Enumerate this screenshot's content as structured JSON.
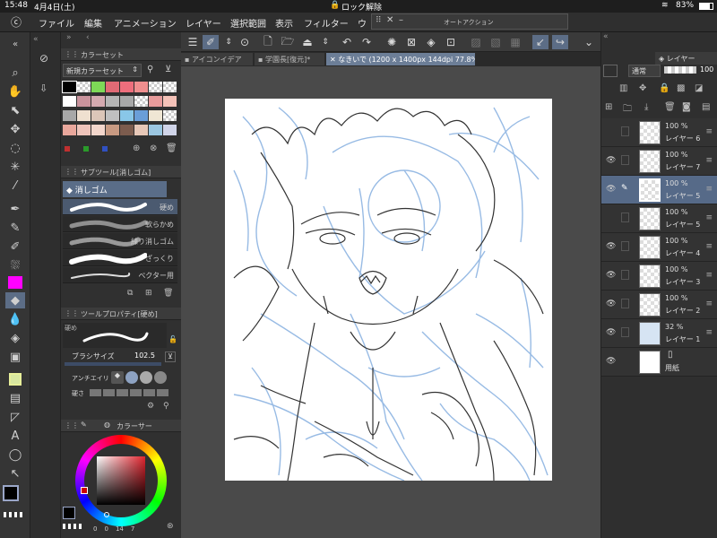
{
  "status": {
    "time": "15:48",
    "date": "4月4日(土)",
    "lock": "ロック解除",
    "battery": "83%"
  },
  "menu": [
    "ファイル",
    "編集",
    "アニメーション",
    "レイヤー",
    "選択範囲",
    "表示",
    "フィルター",
    "ウ"
  ],
  "auto_action": {
    "title": "オートアクション"
  },
  "tabs": [
    {
      "label": "アイコンイデア"
    },
    {
      "label": "学園長[復元]*"
    },
    {
      "label": "なきいで (1200 x 1400px 144dpi 77.8%)"
    }
  ],
  "color_set": {
    "panel_title": "カラーセット",
    "set_name": "新規カラーセット",
    "colors": [
      "#000000",
      "checker",
      "#7ed957",
      "#e06a75",
      "#ee6e7c",
      "#f08f8f",
      "checker",
      "checker",
      "#ffffff",
      "#c9939c",
      "#d4aab0",
      "#b5b5b5",
      "#a8a8a8",
      "checker",
      "#e79b9b",
      "#f4c2b8",
      "#a8a8a8",
      "#efe0d0",
      "#dcc6b8",
      "#c0c0c0",
      "#89c7e8",
      "#6a9ed8",
      "#efe6d4",
      "checker",
      "#e9a79c",
      "#eec3ba",
      "#f3d6cb",
      "#c89a82",
      "#7c5c4e",
      "#e7c8b8",
      "#9bc6e0",
      "#d0d4e8"
    ]
  },
  "subtool": {
    "panel_title": "サブツール[消しゴム]",
    "active": "消しゴム",
    "brushes": [
      "硬め",
      "軟らかめ",
      "練り消しゴム",
      "ざっくり",
      "ベクター用"
    ]
  },
  "tool_property": {
    "panel_title": "ツールプロパティ[硬め]",
    "preset": "硬め",
    "brush_size_label": "ブラシサイズ",
    "brush_size": "102.5",
    "antialias_label": "アンチエイリ",
    "hardness_label": "硬さ"
  },
  "color_wheel": {
    "panel_title": "カラーサー",
    "values": [
      "0",
      "0",
      "14",
      "7"
    ]
  },
  "layers": {
    "panel_title": "レイヤー",
    "blend_mode": "通常",
    "opacity": "100",
    "items": [
      {
        "pct": "100 %",
        "name": "レイヤー 6",
        "visible": false,
        "active": false
      },
      {
        "pct": "100 %",
        "name": "レイヤー 7",
        "visible": true,
        "active": false
      },
      {
        "pct": "100 %",
        "name": "レイヤー 5",
        "visible": true,
        "active": true
      },
      {
        "pct": "100 %",
        "name": "レイヤー 5",
        "visible": false,
        "active": false
      },
      {
        "pct": "100 %",
        "name": "レイヤー 4",
        "visible": true,
        "active": false
      },
      {
        "pct": "100 %",
        "name": "レイヤー 3",
        "visible": true,
        "active": false
      },
      {
        "pct": "100 %",
        "name": "レイヤー 2",
        "visible": true,
        "active": false
      },
      {
        "pct": "32 %",
        "name": "レイヤー 1",
        "visible": true,
        "active": false
      },
      {
        "pct": "",
        "name": "用紙",
        "visible": true,
        "active": false
      }
    ]
  },
  "colors": {
    "accent": "#5c6d86",
    "active_tab": "#6c7e97",
    "sketch_blue": "#8db4e2",
    "line_dark": "#333333",
    "magenta_swatch": "#ff00ff",
    "main_color": "#000000"
  },
  "icons": [
    "app-logo-icon",
    "search-icon",
    "hand-icon",
    "zoom-icon",
    "move-icon",
    "lasso-icon",
    "wand-icon",
    "eyedropper-icon",
    "pen-icon",
    "pencil-icon",
    "brush-icon",
    "airbrush-icon",
    "eraser-icon",
    "blend-icon",
    "fill-icon",
    "gradient-icon",
    "figure-icon",
    "frame-icon",
    "ruler-icon",
    "text-icon",
    "balloon-icon",
    "operation-icon"
  ]
}
